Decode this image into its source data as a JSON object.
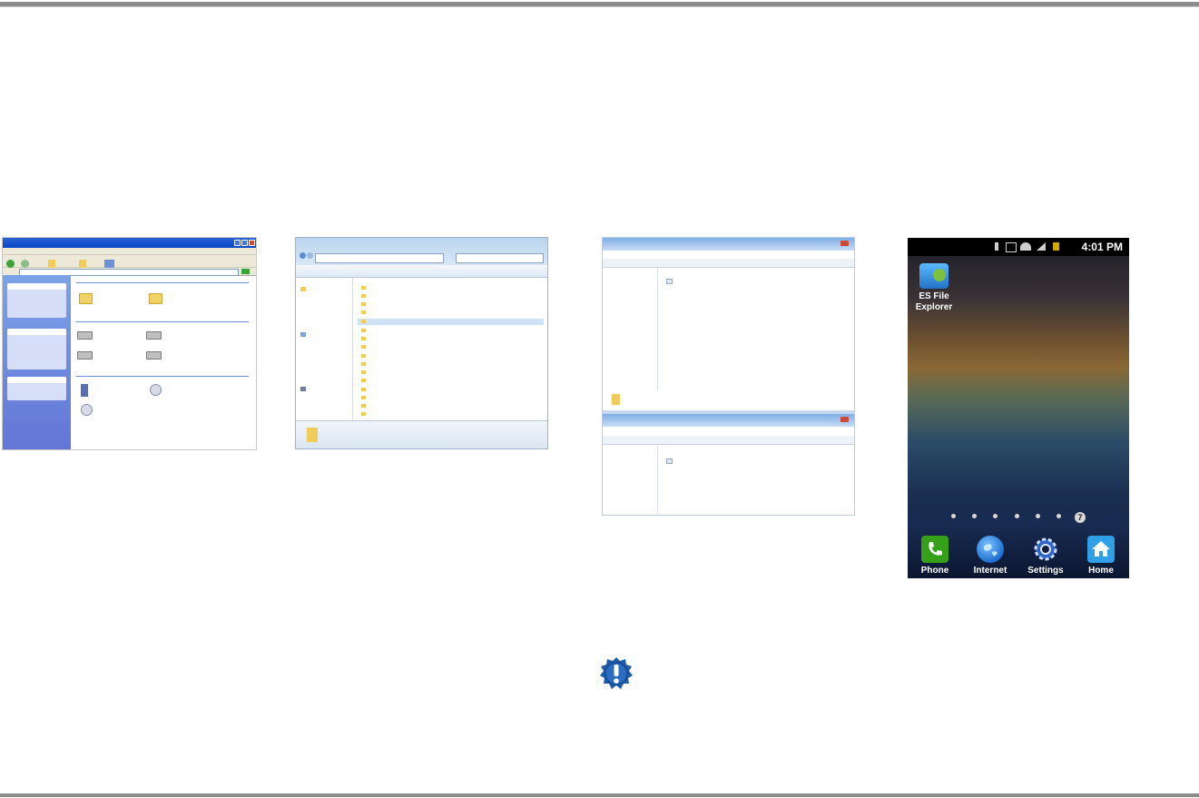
{
  "phone": {
    "time": "4:01 PM",
    "desktop_app_label": "ES File Explorer",
    "page_indicator": "7",
    "dock": [
      {
        "label": "Phone",
        "icon": "phone-icon",
        "color": "#35a018"
      },
      {
        "label": "Internet",
        "icon": "globe-icon",
        "color": "#1e6fd0"
      },
      {
        "label": "Settings",
        "icon": "gear-icon",
        "color": "#2f63c6"
      },
      {
        "label": "Home",
        "icon": "home-icon",
        "color": "#2fa0e6"
      }
    ]
  },
  "note": {
    "icon": "exclamation-gear-icon",
    "color": "#1f5ca8"
  }
}
